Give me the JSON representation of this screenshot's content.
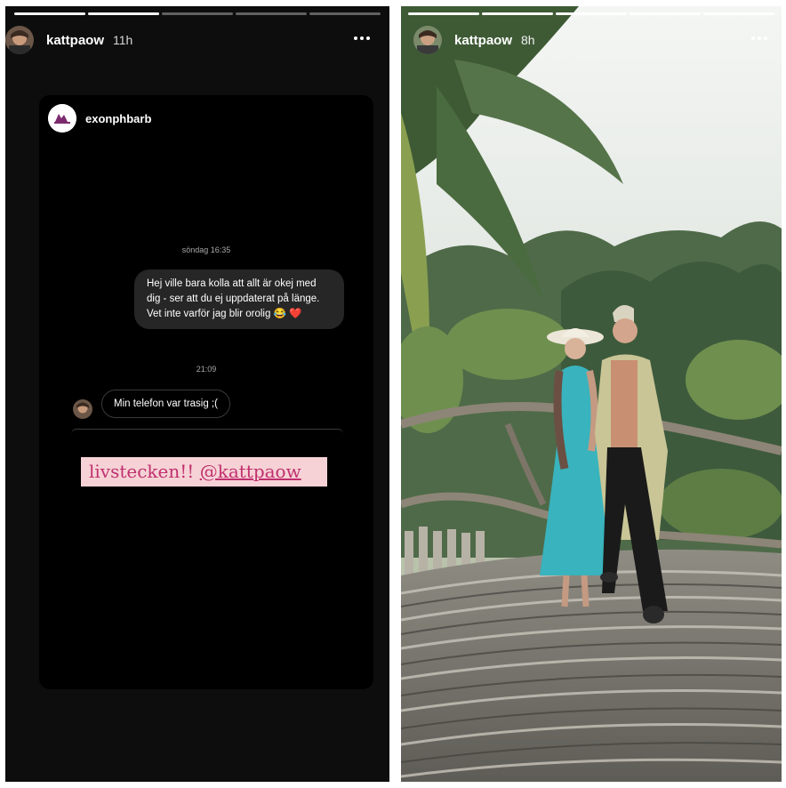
{
  "left_story": {
    "username": "kattpaow",
    "time_ago": "11h",
    "progress_segments": [
      1,
      1,
      0,
      0,
      0
    ],
    "dm": {
      "sender": "exonphbarb",
      "timestamp_1": "söndag 16:35",
      "outgoing_message": "Hej ville bara kolla att allt är okej med dig - ser att du ej uppdaterat på länge. Vet inte varför jag blir orolig 😂 ❤️",
      "timestamp_2": "21:09",
      "incoming_message": "Min telefon var trasig ;("
    },
    "sticker": {
      "text": "livstecken!!",
      "mention": "@kattpaow"
    }
  },
  "right_story": {
    "username": "kattpaow",
    "time_ago": "8h",
    "progress_segments": [
      1,
      1,
      1,
      1,
      1
    ]
  },
  "icons": {
    "more": "more-horizontal-icon"
  }
}
